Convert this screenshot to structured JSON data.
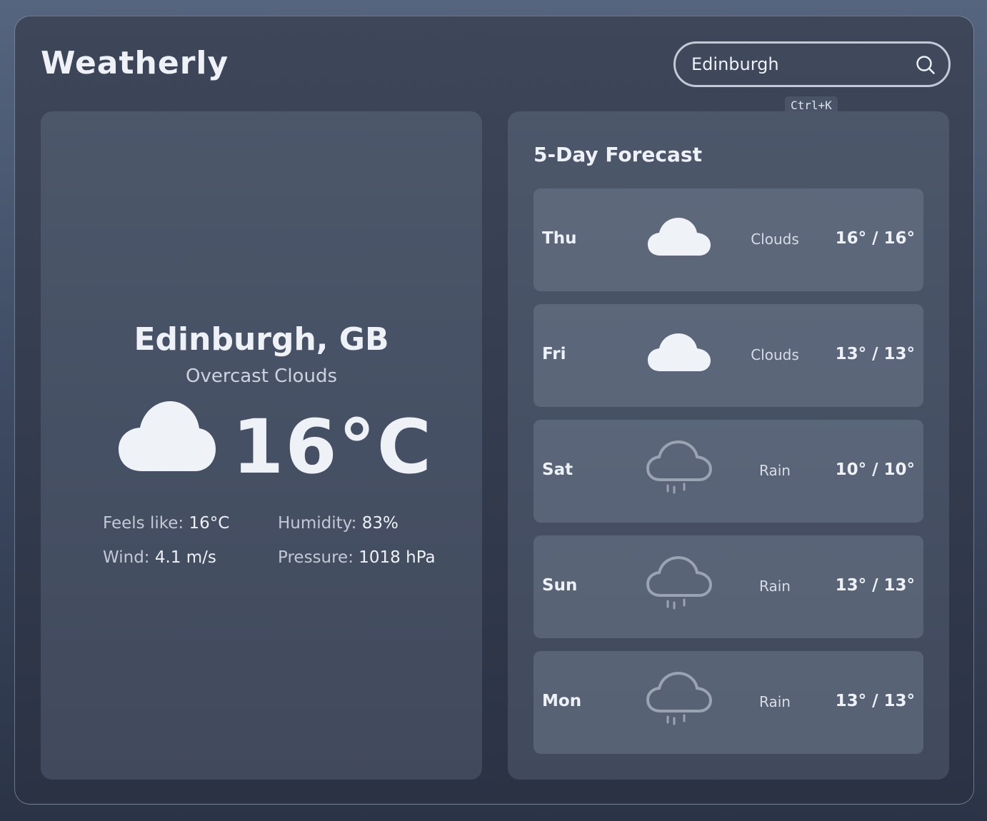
{
  "app": {
    "title": "Weatherly"
  },
  "search": {
    "value": "Edinburgh",
    "shortcut": "Ctrl+K",
    "icon": "search-icon"
  },
  "current": {
    "location": "Edinburgh, GB",
    "condition": "Overcast Clouds",
    "icon": "cloud-icon",
    "temperature": "16°C",
    "feels_like_label": "Feels like:",
    "feels_like_value": "16°C",
    "humidity_label": "Humidity:",
    "humidity_value": "83%",
    "wind_label": "Wind:",
    "wind_value": "4.1 m/s",
    "pressure_label": "Pressure:",
    "pressure_value": "1018 hPa"
  },
  "forecast": {
    "title": "5-Day Forecast",
    "days": [
      {
        "day": "Thu",
        "icon": "cloud-icon",
        "condition": "Clouds",
        "temps": "16° / 16°"
      },
      {
        "day": "Fri",
        "icon": "cloud-icon",
        "condition": "Clouds",
        "temps": "13° / 13°"
      },
      {
        "day": "Sat",
        "icon": "rain-icon",
        "condition": "Rain",
        "temps": "10° / 10°"
      },
      {
        "day": "Sun",
        "icon": "rain-icon",
        "condition": "Rain",
        "temps": "13° / 13°"
      },
      {
        "day": "Mon",
        "icon": "rain-icon",
        "condition": "Rain",
        "temps": "13° / 13°"
      }
    ]
  },
  "colors": {
    "text": "#eef1f6",
    "muted": "#c3c9d4",
    "panel": "#4a5467",
    "row": "#5b6477",
    "cloud_fill": "#eff2f7",
    "rain_stroke": "#9aa3b2"
  }
}
